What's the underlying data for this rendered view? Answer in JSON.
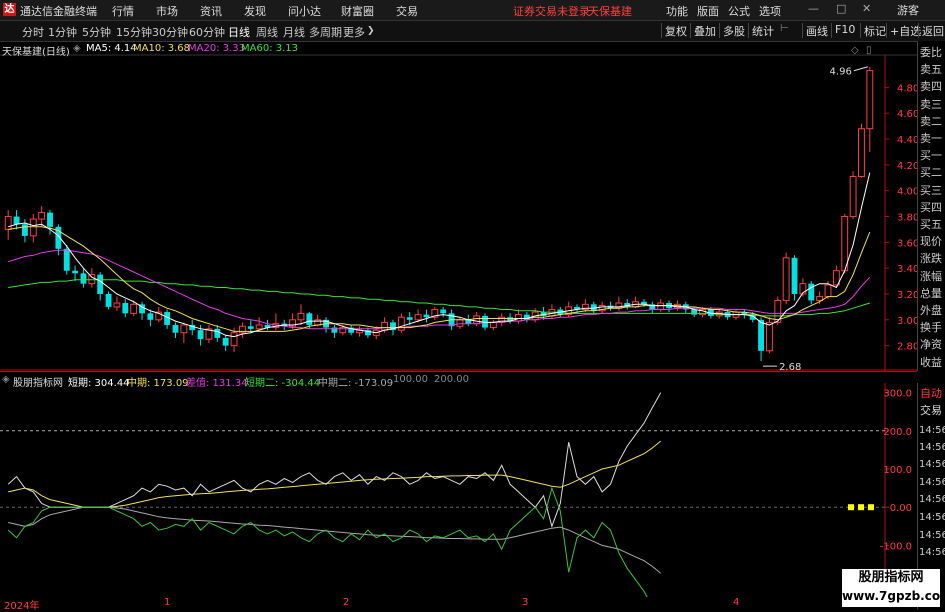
{
  "app": {
    "logo_glyph": "达",
    "title": "通达信金融终端"
  },
  "menu": [
    "行情",
    "市场",
    "资讯",
    "发现",
    "问小达",
    "财富圈",
    "交易"
  ],
  "notice": {
    "trade": "证券交易未登录",
    "stock": "天保基建"
  },
  "right_menu": [
    "功能",
    "版面",
    "公式",
    "选项"
  ],
  "window_buttons": {
    "min": "—",
    "max": "□",
    "close": "✕",
    "guest": "游客"
  },
  "periods": [
    "分时",
    "1分钟",
    "5分钟",
    "15分钟",
    "30分钟",
    "60分钟",
    "日线",
    "周线",
    "月线",
    "多周期",
    "更多"
  ],
  "active_period": "日线",
  "tools": [
    "复权",
    "叠加",
    "多股",
    "统计",
    "画线",
    "F10",
    "标记",
    "+自选",
    "返回"
  ],
  "infobar": {
    "stock_label": "天保基建(日线)",
    "ma5": "MA5: 4.14",
    "ma10": "MA10: 3.68",
    "ma20": "MA20: 3.33",
    "ma60": "MA60: 3.13"
  },
  "price_axis": [
    "4.80",
    "4.60",
    "4.40",
    "4.20",
    "4.00",
    "3.80",
    "3.60",
    "3.40",
    "3.20",
    "3.00",
    "2.80"
  ],
  "high_label": "4.96",
  "low_label": "2.68",
  "right_sidebar": [
    "委比",
    "卖五",
    "卖四",
    "卖三",
    "卖二",
    "卖一",
    "买一",
    "买二",
    "买三",
    "买四",
    "买五",
    "现价",
    "涨跌",
    "涨幅",
    "总量",
    "外盘",
    "换手",
    "净资",
    "收益"
  ],
  "indicator": {
    "name": "股朋指标网",
    "short": "短期: 304.44",
    "mid": "中期: 173.09",
    "diff": "差值: 131.34",
    "short2": "短期二: -304.44",
    "mid2": "中期二: -173.09",
    "p1": "100.00",
    "p2": "200.00"
  },
  "sub_axis": [
    "300.0",
    "200.0",
    "100.0",
    "0.00",
    "-100.0",
    "-200.0"
  ],
  "sub_side": {
    "auto": "自动",
    "trade": "交易"
  },
  "time_items": [
    "14:56",
    "14:56",
    "14:56",
    "14:56",
    "14:56",
    "14:56",
    "14:56",
    "14:56"
  ],
  "dates": [
    "2024年",
    "1",
    "2",
    "3",
    "4"
  ],
  "watermark": {
    "line1": "股朋指标网",
    "line2": "www.7gpzb.com"
  },
  "colors": {
    "up": "#ff4040",
    "down": "#00e0e0",
    "ma5": "#ffffff",
    "ma10": "#f0e060",
    "ma20": "#e040e0",
    "ma60": "#40e040",
    "grid": "#b01010"
  },
  "chart_data": {
    "type": "candlestick",
    "price_range": [
      2.68,
      4.96
    ],
    "candles": [
      [
        3.7,
        3.8,
        3.85,
        3.62
      ],
      [
        3.8,
        3.74,
        3.85,
        3.7
      ],
      [
        3.74,
        3.65,
        3.78,
        3.6
      ],
      [
        3.65,
        3.78,
        3.82,
        3.6
      ],
      [
        3.78,
        3.83,
        3.88,
        3.72
      ],
      [
        3.83,
        3.72,
        3.85,
        3.66
      ],
      [
        3.72,
        3.55,
        3.74,
        3.5
      ],
      [
        3.55,
        3.38,
        3.58,
        3.35
      ],
      [
        3.38,
        3.36,
        3.42,
        3.3
      ],
      [
        3.36,
        3.28,
        3.4,
        3.25
      ],
      [
        3.28,
        3.35,
        3.4,
        3.25
      ],
      [
        3.35,
        3.2,
        3.37,
        3.15
      ],
      [
        3.2,
        3.1,
        3.22,
        3.08
      ],
      [
        3.1,
        3.13,
        3.18,
        3.07
      ],
      [
        3.13,
        3.05,
        3.16,
        3.02
      ],
      [
        3.05,
        3.12,
        3.15,
        3.03
      ],
      [
        3.12,
        3.05,
        3.14,
        3.0
      ],
      [
        3.05,
        3.0,
        3.08,
        2.95
      ],
      [
        3.0,
        3.06,
        3.1,
        2.98
      ],
      [
        3.06,
        2.96,
        3.08,
        2.93
      ],
      [
        2.96,
        2.9,
        2.98,
        2.86
      ],
      [
        2.9,
        2.96,
        2.98,
        2.82
      ],
      [
        2.96,
        2.92,
        3.0,
        2.88
      ],
      [
        2.92,
        2.85,
        2.96,
        2.8
      ],
      [
        2.85,
        2.93,
        2.96,
        2.82
      ],
      [
        2.93,
        2.86,
        2.96,
        2.83
      ],
      [
        2.86,
        2.8,
        2.88,
        2.76
      ],
      [
        2.8,
        2.9,
        2.94,
        2.75
      ],
      [
        2.9,
        2.95,
        2.98,
        2.86
      ],
      [
        2.95,
        2.93,
        3.0,
        2.9
      ],
      [
        2.93,
        2.96,
        3.02,
        2.92
      ],
      [
        2.96,
        2.94,
        3.0,
        2.92
      ],
      [
        2.94,
        2.97,
        3.05,
        2.92
      ],
      [
        2.97,
        2.95,
        3.0,
        2.92
      ],
      [
        2.95,
        3.0,
        3.05,
        2.93
      ],
      [
        3.0,
        3.05,
        3.12,
        2.96
      ],
      [
        3.05,
        2.96,
        3.06,
        2.93
      ],
      [
        2.96,
        3.0,
        3.04,
        2.95
      ],
      [
        3.0,
        2.94,
        3.02,
        2.9
      ],
      [
        2.94,
        2.9,
        2.96,
        2.86
      ],
      [
        2.9,
        2.94,
        2.96,
        2.88
      ],
      [
        2.94,
        2.9,
        2.96,
        2.88
      ],
      [
        2.9,
        2.92,
        2.95,
        2.87
      ],
      [
        2.92,
        2.88,
        2.94,
        2.86
      ],
      [
        2.88,
        2.92,
        2.95,
        2.85
      ],
      [
        2.92,
        2.98,
        3.02,
        2.9
      ],
      [
        2.98,
        2.92,
        3.0,
        2.88
      ],
      [
        2.92,
        3.02,
        3.05,
        2.9
      ],
      [
        3.02,
        3.0,
        3.06,
        2.96
      ],
      [
        3.0,
        3.04,
        3.08,
        2.98
      ],
      [
        3.04,
        3.02,
        3.08,
        2.98
      ],
      [
        3.02,
        3.08,
        3.1,
        3.0
      ],
      [
        3.08,
        3.05,
        3.1,
        3.02
      ],
      [
        3.05,
        2.95,
        3.08,
        2.92
      ],
      [
        2.95,
        3.0,
        3.02,
        2.93
      ],
      [
        3.0,
        2.97,
        3.04,
        2.95
      ],
      [
        2.97,
        3.03,
        3.06,
        2.95
      ],
      [
        3.03,
        2.94,
        3.05,
        2.92
      ],
      [
        2.94,
        2.98,
        3.0,
        2.92
      ],
      [
        2.98,
        3.02,
        3.05,
        2.95
      ],
      [
        3.02,
        2.99,
        3.05,
        2.97
      ],
      [
        2.99,
        3.04,
        3.08,
        2.97
      ],
      [
        3.04,
        3.0,
        3.06,
        2.98
      ],
      [
        3.0,
        3.06,
        3.09,
        2.98
      ],
      [
        3.06,
        3.03,
        3.1,
        3.0
      ],
      [
        3.03,
        3.08,
        3.12,
        3.01
      ],
      [
        3.08,
        3.04,
        3.1,
        3.02
      ],
      [
        3.04,
        3.1,
        3.14,
        3.02
      ],
      [
        3.1,
        3.08,
        3.12,
        3.05
      ],
      [
        3.08,
        3.12,
        3.16,
        3.06
      ],
      [
        3.12,
        3.07,
        3.14,
        3.05
      ],
      [
        3.07,
        3.11,
        3.14,
        3.05
      ],
      [
        3.11,
        3.09,
        3.14,
        3.07
      ],
      [
        3.09,
        3.13,
        3.18,
        3.07
      ],
      [
        3.13,
        3.1,
        3.16,
        3.08
      ],
      [
        3.1,
        3.14,
        3.18,
        3.09
      ],
      [
        3.14,
        3.12,
        3.16,
        3.1
      ],
      [
        3.12,
        3.08,
        3.14,
        3.05
      ],
      [
        3.08,
        3.13,
        3.16,
        3.06
      ],
      [
        3.13,
        3.09,
        3.15,
        3.06
      ],
      [
        3.09,
        3.12,
        3.15,
        3.07
      ],
      [
        3.12,
        3.08,
        3.14,
        3.05
      ],
      [
        3.08,
        3.04,
        3.1,
        3.02
      ],
      [
        3.04,
        3.08,
        3.1,
        3.02
      ],
      [
        3.08,
        3.03,
        3.1,
        3.01
      ],
      [
        3.03,
        3.06,
        3.08,
        3.01
      ],
      [
        3.06,
        3.02,
        3.08,
        3.0
      ],
      [
        3.02,
        3.06,
        3.08,
        3.0
      ],
      [
        3.06,
        3.04,
        3.08,
        3.01
      ],
      [
        3.04,
        3.0,
        3.06,
        2.98
      ],
      [
        3.0,
        2.76,
        3.02,
        2.68
      ],
      [
        2.76,
        2.98,
        3.02,
        2.74
      ],
      [
        2.98,
        3.15,
        3.18,
        2.96
      ],
      [
        3.15,
        3.48,
        3.52,
        3.12
      ],
      [
        3.48,
        3.2,
        3.5,
        3.15
      ],
      [
        3.2,
        3.28,
        3.32,
        3.18
      ],
      [
        3.28,
        3.15,
        3.3,
        3.12
      ],
      [
        3.15,
        3.18,
        3.22,
        3.12
      ],
      [
        3.18,
        3.27,
        3.3,
        3.16
      ],
      [
        3.27,
        3.38,
        3.42,
        3.25
      ],
      [
        3.38,
        3.8,
        3.82,
        3.36
      ],
      [
        3.8,
        4.11,
        4.15,
        3.78
      ],
      [
        4.11,
        4.48,
        4.52,
        4.1
      ],
      [
        4.48,
        4.93,
        4.96,
        4.3
      ]
    ],
    "ma5": [
      3.72,
      3.74,
      3.75,
      3.73,
      3.74,
      3.7,
      3.65,
      3.57,
      3.48,
      3.4,
      3.33,
      3.3,
      3.25,
      3.2,
      3.17,
      3.14,
      3.1,
      3.07,
      3.05,
      3.02,
      2.99,
      2.97,
      2.95,
      2.93,
      2.92,
      2.91,
      2.88,
      2.87,
      2.89,
      2.9,
      2.92,
      2.94,
      2.95,
      2.96,
      2.96,
      2.97,
      2.99,
      2.99,
      2.99,
      2.97,
      2.95,
      2.93,
      2.92,
      2.91,
      2.9,
      2.92,
      2.93,
      2.95,
      2.97,
      2.99,
      3.01,
      3.03,
      3.04,
      3.03,
      3.02,
      3.0,
      2.99,
      2.98,
      2.98,
      2.99,
      2.99,
      3.01,
      3.01,
      3.03,
      3.04,
      3.05,
      3.06,
      3.07,
      3.08,
      3.09,
      3.09,
      3.1,
      3.1,
      3.1,
      3.11,
      3.12,
      3.12,
      3.11,
      3.11,
      3.11,
      3.1,
      3.1,
      3.08,
      3.07,
      3.05,
      3.05,
      3.04,
      3.04,
      3.04,
      3.03,
      2.98,
      2.96,
      2.99,
      3.07,
      3.11,
      3.21,
      3.25,
      3.28,
      3.28,
      3.25,
      3.38,
      3.58,
      3.87,
      4.14
    ],
    "ma10": [
      3.7,
      3.71,
      3.72,
      3.72,
      3.72,
      3.71,
      3.69,
      3.65,
      3.61,
      3.57,
      3.52,
      3.47,
      3.41,
      3.35,
      3.29,
      3.24,
      3.21,
      3.16,
      3.12,
      3.09,
      3.07,
      3.04,
      3.01,
      2.99,
      2.97,
      2.95,
      2.93,
      2.91,
      2.91,
      2.91,
      2.91,
      2.91,
      2.91,
      2.91,
      2.92,
      2.93,
      2.95,
      2.96,
      2.97,
      2.97,
      2.97,
      2.96,
      2.96,
      2.95,
      2.94,
      2.94,
      2.94,
      2.94,
      2.94,
      2.95,
      2.96,
      2.98,
      2.99,
      3.0,
      3.0,
      3.0,
      3.01,
      3.01,
      3.01,
      3.01,
      3.01,
      3.01,
      3.01,
      3.02,
      3.02,
      3.03,
      3.04,
      3.05,
      3.06,
      3.07,
      3.07,
      3.08,
      3.09,
      3.09,
      3.1,
      3.1,
      3.11,
      3.11,
      3.11,
      3.11,
      3.11,
      3.1,
      3.1,
      3.09,
      3.08,
      3.08,
      3.07,
      3.06,
      3.06,
      3.05,
      3.03,
      3.01,
      3.0,
      3.02,
      3.04,
      3.08,
      3.11,
      3.14,
      3.18,
      3.18,
      3.22,
      3.35,
      3.52,
      3.68
    ],
    "ma20": [
      3.45,
      3.47,
      3.49,
      3.5,
      3.52,
      3.53,
      3.54,
      3.54,
      3.53,
      3.52,
      3.51,
      3.49,
      3.46,
      3.43,
      3.4,
      3.37,
      3.34,
      3.31,
      3.28,
      3.25,
      3.22,
      3.19,
      3.16,
      3.13,
      3.1,
      3.08,
      3.05,
      3.03,
      3.01,
      3.0,
      2.99,
      2.97,
      2.96,
      2.95,
      2.94,
      2.94,
      2.93,
      2.93,
      2.93,
      2.93,
      2.93,
      2.93,
      2.93,
      2.93,
      2.93,
      2.94,
      2.94,
      2.94,
      2.95,
      2.95,
      2.95,
      2.96,
      2.96,
      2.96,
      2.97,
      2.97,
      2.97,
      2.98,
      2.98,
      2.98,
      2.99,
      2.99,
      3.0,
      3.0,
      3.01,
      3.01,
      3.02,
      3.02,
      3.03,
      3.04,
      3.04,
      3.05,
      3.05,
      3.06,
      3.06,
      3.07,
      3.07,
      3.08,
      3.08,
      3.08,
      3.09,
      3.09,
      3.09,
      3.09,
      3.09,
      3.09,
      3.08,
      3.08,
      3.08,
      3.07,
      3.06,
      3.05,
      3.05,
      3.05,
      3.05,
      3.06,
      3.07,
      3.08,
      3.09,
      3.1,
      3.12,
      3.18,
      3.26,
      3.33
    ],
    "ma60": [
      3.25,
      3.26,
      3.27,
      3.28,
      3.29,
      3.29,
      3.3,
      3.3,
      3.31,
      3.31,
      3.31,
      3.31,
      3.31,
      3.31,
      3.3,
      3.3,
      3.3,
      3.29,
      3.29,
      3.28,
      3.28,
      3.27,
      3.27,
      3.26,
      3.26,
      3.25,
      3.25,
      3.24,
      3.24,
      3.23,
      3.23,
      3.22,
      3.22,
      3.21,
      3.21,
      3.2,
      3.2,
      3.19,
      3.19,
      3.18,
      3.18,
      3.17,
      3.17,
      3.16,
      3.16,
      3.15,
      3.15,
      3.14,
      3.14,
      3.13,
      3.13,
      3.12,
      3.12,
      3.11,
      3.11,
      3.1,
      3.1,
      3.09,
      3.09,
      3.08,
      3.08,
      3.07,
      3.07,
      3.07,
      3.06,
      3.06,
      3.06,
      3.05,
      3.05,
      3.05,
      3.05,
      3.05,
      3.05,
      3.05,
      3.05,
      3.05,
      3.05,
      3.05,
      3.05,
      3.05,
      3.05,
      3.05,
      3.05,
      3.05,
      3.05,
      3.04,
      3.04,
      3.04,
      3.04,
      3.04,
      3.03,
      3.03,
      3.03,
      3.03,
      3.04,
      3.04,
      3.04,
      3.05,
      3.05,
      3.06,
      3.07,
      3.09,
      3.11,
      3.13
    ],
    "indicator_range": [
      -230,
      320
    ],
    "short": [
      60,
      80,
      50,
      40,
      10,
      0,
      0,
      0,
      0,
      0,
      0,
      0,
      0,
      10,
      20,
      30,
      50,
      40,
      60,
      55,
      45,
      50,
      30,
      60,
      40,
      50,
      60,
      70,
      50,
      40,
      60,
      70,
      60,
      75,
      65,
      80,
      90,
      70,
      60,
      80,
      90,
      70,
      85,
      60,
      80,
      70,
      90,
      80,
      60,
      70,
      90,
      75,
      80,
      70,
      60,
      80,
      75,
      90,
      70,
      110,
      60,
      40,
      20,
      0,
      30,
      -50,
      10,
      170,
      80,
      60,
      80,
      40,
      60,
      120,
      160,
      190,
      220,
      260,
      300
    ],
    "mid": [
      40,
      45,
      50,
      45,
      30,
      20,
      15,
      10,
      5,
      0,
      0,
      0,
      0,
      2,
      5,
      10,
      15,
      20,
      25,
      28,
      30,
      32,
      34,
      35,
      36,
      38,
      40,
      42,
      44,
      45,
      47,
      48,
      50,
      52,
      54,
      56,
      58,
      60,
      62,
      64,
      66,
      68,
      70,
      72,
      73,
      74,
      75,
      76,
      77,
      78,
      80,
      80,
      81,
      82,
      82,
      83,
      83,
      84,
      84,
      84,
      80,
      75,
      70,
      65,
      60,
      55,
      52,
      60,
      70,
      80,
      90,
      100,
      105,
      110,
      120,
      130,
      140,
      155,
      173
    ],
    "short2": [
      -60,
      -80,
      -50,
      -40,
      -10,
      0,
      0,
      0,
      0,
      0,
      0,
      0,
      0,
      -10,
      -20,
      -30,
      -50,
      -40,
      -60,
      -55,
      -45,
      -50,
      -30,
      -60,
      -40,
      -50,
      -60,
      -70,
      -50,
      -40,
      -60,
      -70,
      -60,
      -75,
      -65,
      -80,
      -90,
      -70,
      -60,
      -80,
      -90,
      -70,
      -85,
      -60,
      -80,
      -70,
      -90,
      -80,
      -60,
      -70,
      -90,
      -75,
      -80,
      -70,
      -60,
      -80,
      -75,
      -90,
      -70,
      -110,
      -60,
      -40,
      -20,
      0,
      -30,
      50,
      -10,
      -170,
      -80,
      -60,
      -80,
      -40,
      -60,
      -120,
      -160,
      -190,
      -220,
      -260,
      -304
    ],
    "mid2": [
      -40,
      -45,
      -50,
      -45,
      -30,
      -20,
      -15,
      -10,
      -5,
      0,
      0,
      0,
      0,
      -2,
      -5,
      -10,
      -15,
      -20,
      -25,
      -28,
      -30,
      -32,
      -34,
      -35,
      -36,
      -38,
      -40,
      -42,
      -44,
      -45,
      -47,
      -48,
      -50,
      -52,
      -54,
      -56,
      -58,
      -60,
      -62,
      -64,
      -66,
      -68,
      -70,
      -72,
      -73,
      -74,
      -75,
      -76,
      -77,
      -78,
      -80,
      -80,
      -81,
      -82,
      -82,
      -83,
      -83,
      -84,
      -84,
      -84,
      -80,
      -75,
      -70,
      -65,
      -60,
      -55,
      -52,
      -60,
      -70,
      -80,
      -90,
      -100,
      -105,
      -110,
      -120,
      -130,
      -140,
      -155,
      -173
    ]
  }
}
